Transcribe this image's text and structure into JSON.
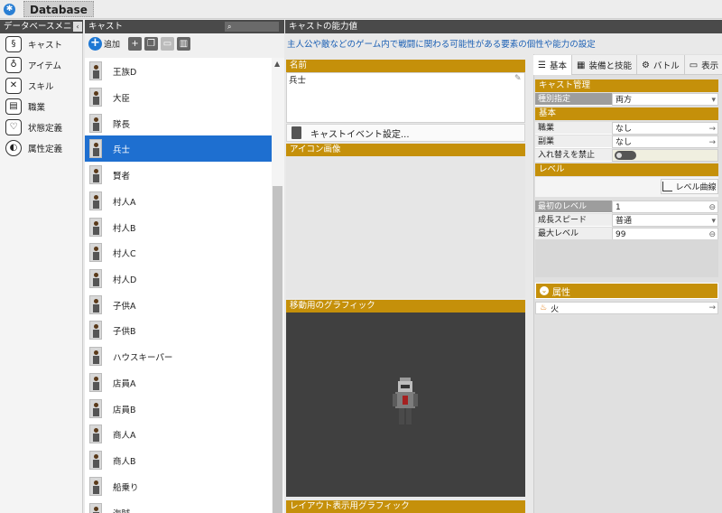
{
  "window": {
    "title": "Database"
  },
  "headers": {
    "menu": "データベースメニュー",
    "cast": "キャスト",
    "ability": "キャストの能力値"
  },
  "menu": [
    {
      "label": "キャスト",
      "icon": "scroll-icon"
    },
    {
      "label": "アイテム",
      "icon": "potion-icon"
    },
    {
      "label": "スキル",
      "icon": "swords-icon"
    },
    {
      "label": "職業",
      "icon": "job-board-icon"
    },
    {
      "label": "状態定義",
      "icon": "status-heart-icon"
    },
    {
      "label": "属性定義",
      "icon": "attribute-disc-icon"
    }
  ],
  "toolbar": {
    "add_label": "追加"
  },
  "cast_list": [
    "王族D",
    "大臣",
    "隊長",
    "兵士",
    "賢者",
    "村人A",
    "村人B",
    "村人C",
    "村人D",
    "子供A",
    "子供B",
    "ハウスキーパー",
    "店員A",
    "店員B",
    "商人A",
    "商人B",
    "船乗り",
    "海賊"
  ],
  "selected_cast_index": 3,
  "description": "主人公や敵などのゲーム内で戦闘に関わる可能性がある要素の個性や能力の設定",
  "name_section": {
    "label": "名前",
    "value": "兵士"
  },
  "event_button": "キャストイベント設定...",
  "icon_section": "アイコン画像",
  "move_section": "移動用のグラフィック",
  "layout_section": "レイアウト表示用グラフィック",
  "tabs": [
    {
      "label": "基本",
      "icon": "list-icon"
    },
    {
      "label": "装備と技能",
      "icon": "grid-icon"
    },
    {
      "label": "バトル",
      "icon": "robot-icon"
    },
    {
      "label": "表示",
      "icon": "monitor-icon"
    }
  ],
  "props": {
    "cast_mgmt": "キャスト管理",
    "type_label": "種別指定",
    "type_value": "両方",
    "basic": "基本",
    "job_label": "職業",
    "job_value": "なし",
    "subjob_label": "副業",
    "subjob_value": "なし",
    "swap_label": "入れ替えを禁止",
    "level": "レベル",
    "level_curve": "レベル曲線",
    "first_level_label": "最初のレベル",
    "first_level_value": "1",
    "growth_label": "成長スピード",
    "growth_value": "普通",
    "max_level_label": "最大レベル",
    "max_level_value": "99"
  },
  "attributes": {
    "label": "属性",
    "items": [
      "火"
    ]
  },
  "colors": {
    "accent": "#c5900a",
    "selection": "#1e6fd0",
    "link": "#1a5fb4"
  }
}
